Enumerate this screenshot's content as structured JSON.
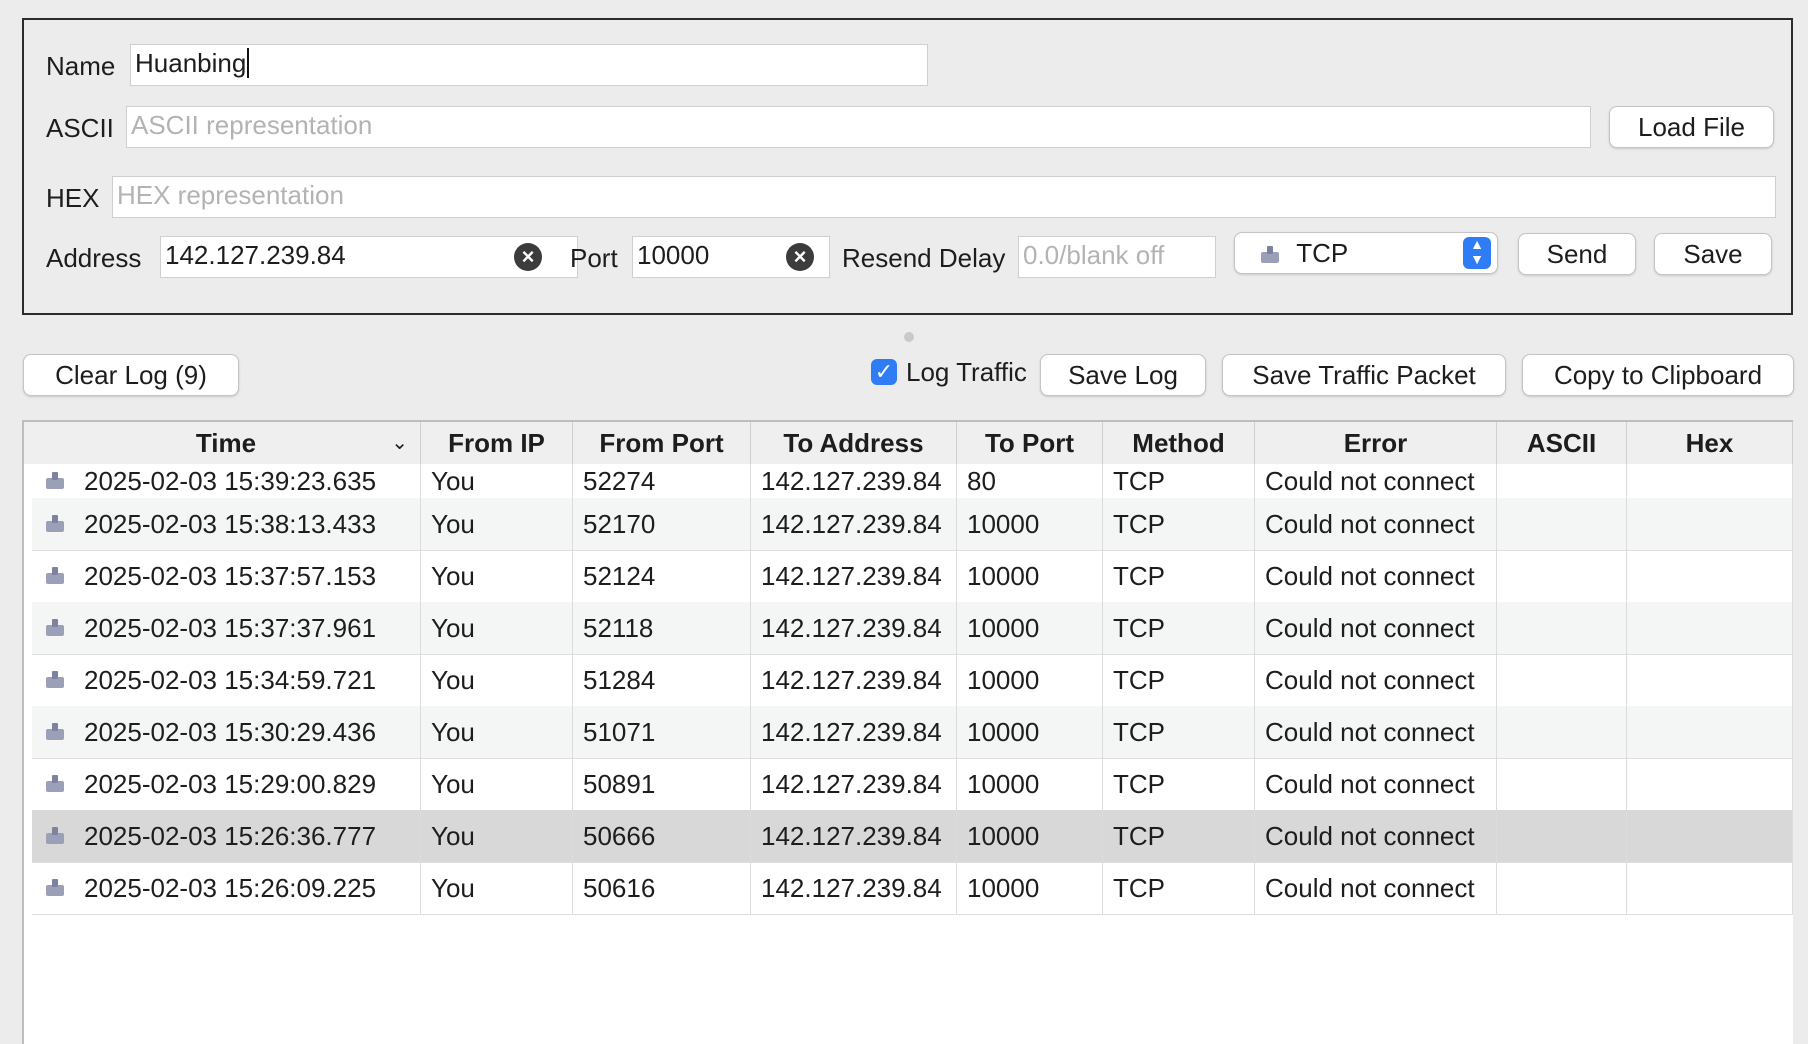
{
  "form": {
    "name_label": "Name",
    "name_value": "Huanbing",
    "ascii_label": "ASCII",
    "ascii_placeholder": "ASCII representation",
    "load_file_label": "Load File",
    "hex_label": "HEX",
    "hex_placeholder": "HEX representation",
    "address_label": "Address",
    "address_value": "142.127.239.84",
    "port_label": "Port",
    "port_value": "10000",
    "resend_label": "Resend Delay",
    "resend_placeholder": "0.0/blank off",
    "method_value": "TCP",
    "send_label": "Send",
    "save_label": "Save"
  },
  "toolbar": {
    "clear_log_label": "Clear Log (9)",
    "log_traffic_label": "Log Traffic",
    "log_traffic_checked": true,
    "save_log_label": "Save Log",
    "save_packet_label": "Save Traffic Packet",
    "copy_label": "Copy to Clipboard"
  },
  "table": {
    "columns": [
      "Time",
      "From IP",
      "From Port",
      "To Address",
      "To Port",
      "Method",
      "Error",
      "ASCII",
      "Hex"
    ],
    "rows": [
      {
        "time": "2025-02-03 15:39:23.635",
        "from_ip": "You",
        "from_port": "52274",
        "to_address": "142.127.239.84",
        "to_port": "80",
        "method": "TCP",
        "error": "Could not connect",
        "ascii": "",
        "hex": ""
      },
      {
        "time": "2025-02-03 15:38:13.433",
        "from_ip": "You",
        "from_port": "52170",
        "to_address": "142.127.239.84",
        "to_port": "10000",
        "method": "TCP",
        "error": "Could not connect",
        "ascii": "",
        "hex": ""
      },
      {
        "time": "2025-02-03 15:37:57.153",
        "from_ip": "You",
        "from_port": "52124",
        "to_address": "142.127.239.84",
        "to_port": "10000",
        "method": "TCP",
        "error": "Could not connect",
        "ascii": "",
        "hex": ""
      },
      {
        "time": "2025-02-03 15:37:37.961",
        "from_ip": "You",
        "from_port": "52118",
        "to_address": "142.127.239.84",
        "to_port": "10000",
        "method": "TCP",
        "error": "Could not connect",
        "ascii": "",
        "hex": ""
      },
      {
        "time": "2025-02-03 15:34:59.721",
        "from_ip": "You",
        "from_port": "51284",
        "to_address": "142.127.239.84",
        "to_port": "10000",
        "method": "TCP",
        "error": "Could not connect",
        "ascii": "",
        "hex": ""
      },
      {
        "time": "2025-02-03 15:30:29.436",
        "from_ip": "You",
        "from_port": "51071",
        "to_address": "142.127.239.84",
        "to_port": "10000",
        "method": "TCP",
        "error": "Could not connect",
        "ascii": "",
        "hex": ""
      },
      {
        "time": "2025-02-03 15:29:00.829",
        "from_ip": "You",
        "from_port": "50891",
        "to_address": "142.127.239.84",
        "to_port": "10000",
        "method": "TCP",
        "error": "Could not connect",
        "ascii": "",
        "hex": ""
      },
      {
        "time": "2025-02-03 15:26:36.777",
        "from_ip": "You",
        "from_port": "50666",
        "to_address": "142.127.239.84",
        "to_port": "10000",
        "method": "TCP",
        "error": "Could not connect",
        "ascii": "",
        "hex": "",
        "selected": true
      },
      {
        "time": "2025-02-03 15:26:09.225",
        "from_ip": "You",
        "from_port": "50616",
        "to_address": "142.127.239.84",
        "to_port": "10000",
        "method": "TCP",
        "error": "Could not connect",
        "ascii": "",
        "hex": ""
      }
    ]
  },
  "colors": {
    "accent": "#2f7df6",
    "selected_row": "#d8d8d8",
    "window_bg": "#ececec"
  }
}
